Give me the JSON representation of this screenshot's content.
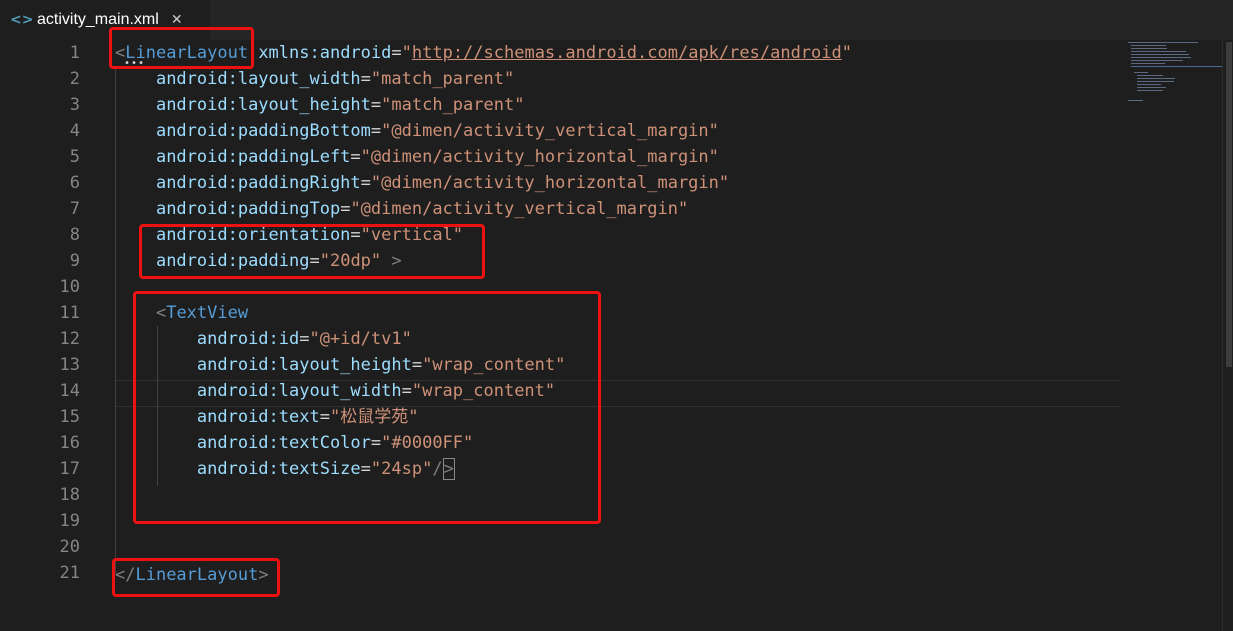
{
  "tab": {
    "title": "activity_main.xml",
    "icon": "code-brackets-icon",
    "close": "✕"
  },
  "line_numbers": [
    "1",
    "2",
    "3",
    "4",
    "5",
    "6",
    "7",
    "8",
    "9",
    "10",
    "11",
    "12",
    "13",
    "14",
    "15",
    "16",
    "17",
    "18",
    "19",
    "20",
    "21"
  ],
  "code": {
    "l1": {
      "open": "<",
      "tag": "LinearLayout",
      "attr": " xmlns:android",
      "eq": "=",
      "q1": "\"",
      "url": "http://schemas.android.com/apk/res/android",
      "q2": "\""
    },
    "l2": {
      "attr": "android:layout_width",
      "eq": "=",
      "val": "\"match_parent\""
    },
    "l3": {
      "attr": "android:layout_height",
      "eq": "=",
      "val": "\"match_parent\""
    },
    "l4": {
      "attr": "android:paddingBottom",
      "eq": "=",
      "val": "\"@dimen/activity_vertical_margin\""
    },
    "l5": {
      "attr": "android:paddingLeft",
      "eq": "=",
      "val": "\"@dimen/activity_horizontal_margin\""
    },
    "l6": {
      "attr": "android:paddingRight",
      "eq": "=",
      "val": "\"@dimen/activity_horizontal_margin\""
    },
    "l7": {
      "attr": "android:paddingTop",
      "eq": "=",
      "val": "\"@dimen/activity_vertical_margin\""
    },
    "l8": {
      "attr": "android:orientation",
      "eq": "=",
      "val": "\"vertical\""
    },
    "l9": {
      "attr": "android:padding",
      "eq": "=",
      "val": "\"20dp\"",
      "close": " >"
    },
    "l11": {
      "open": "<",
      "tag": "TextView"
    },
    "l12": {
      "attr": "android:id",
      "eq": "=",
      "val": "\"@+id/tv1\""
    },
    "l13": {
      "attr": "android:layout_height",
      "eq": "=",
      "val": "\"wrap_content\""
    },
    "l14": {
      "attr": "android:layout_width",
      "eq": "=",
      "val": "\"wrap_content\""
    },
    "l15": {
      "attr": "android:text",
      "eq": "=",
      "val": "\"松鼠学苑\""
    },
    "l16": {
      "attr": "android:textColor",
      "eq": "=",
      "val": "\"#0000FF\""
    },
    "l17": {
      "attr": "android:textSize",
      "eq": "=",
      "val": "\"24sp\"",
      "slash": "/",
      "close": ">"
    },
    "l21": {
      "open": "</",
      "tag": "LinearLayout",
      "close": ">"
    }
  },
  "colors": {
    "highlight": "#ee1111",
    "tag": "#569cd6",
    "attribute": "#9cdcfe",
    "string": "#ce9178"
  }
}
